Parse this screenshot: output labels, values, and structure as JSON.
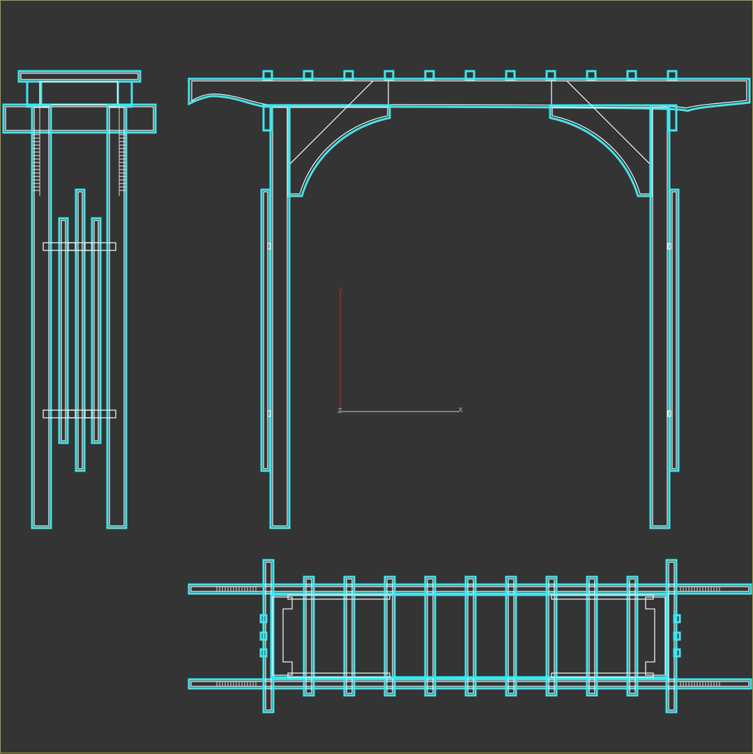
{
  "viewport": {
    "background": "#343434",
    "border_color": "#a6a33a"
  },
  "colors": {
    "outline": "#3fe6ee",
    "edge": "#f2f2f2",
    "axis_y": "#a82828",
    "axis_x": "#9a9a9a"
  },
  "gizmo": {
    "y_label": "y",
    "x_label": "x",
    "z_label": "z"
  },
  "views": [
    "side-view",
    "front-view",
    "top-view"
  ]
}
